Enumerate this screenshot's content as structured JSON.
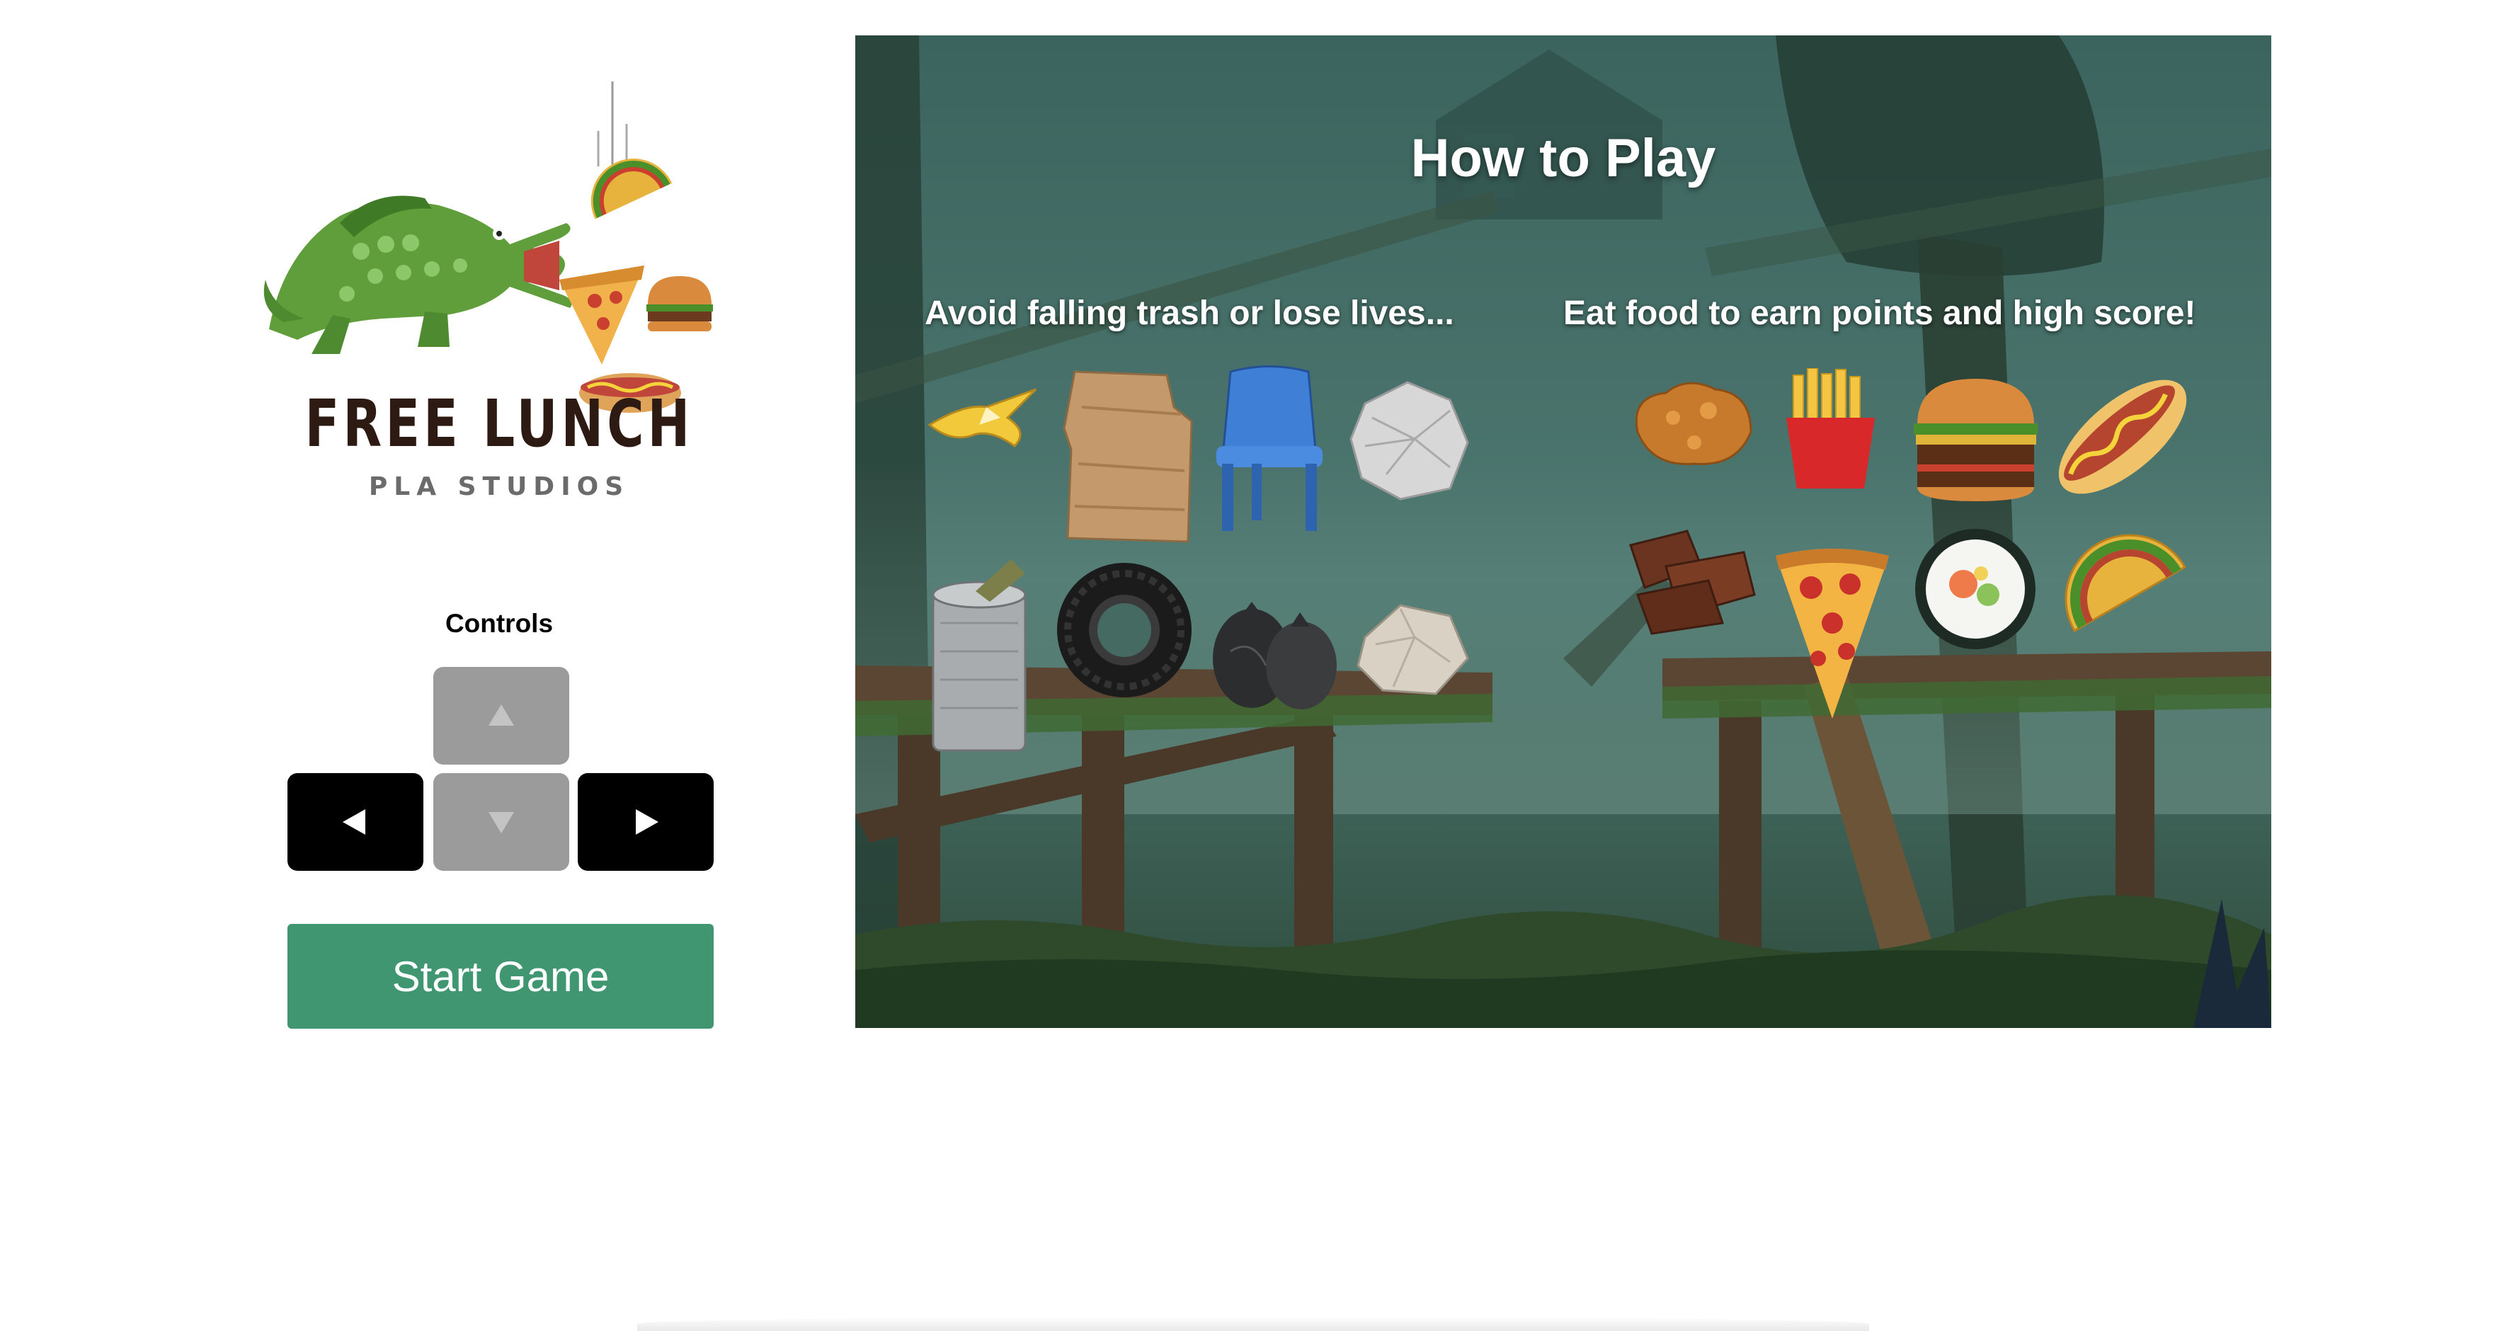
{
  "logo": {
    "title": "FREE LUNCH",
    "subtitle": "PLA STUDIOS"
  },
  "controls": {
    "label": "Controls",
    "keys": [
      {
        "name": "up-arrow-key",
        "icon": "up-arrow-icon",
        "state": "inactive"
      },
      {
        "name": "left-arrow-key",
        "icon": "left-arrow-icon",
        "state": "active"
      },
      {
        "name": "down-arrow-key",
        "icon": "down-arrow-icon",
        "state": "inactive"
      },
      {
        "name": "right-arrow-key",
        "icon": "right-arrow-icon",
        "state": "active"
      }
    ]
  },
  "start_button": {
    "label": "Start Game"
  },
  "how_to_play": {
    "title": "How to Play",
    "trash_heading": "Avoid falling trash or lose lives...",
    "food_heading": "Eat food to earn points and high score!",
    "trash_items": [
      "banana-peel",
      "cardboard",
      "plastic-chair",
      "crumpled-paper",
      "tin-can",
      "tire",
      "trash-bags",
      "foil-ball"
    ],
    "food_items": [
      "fried-chicken",
      "french-fries",
      "burger",
      "hot-dog",
      "jerky",
      "pizza-slice",
      "sushi",
      "taco"
    ]
  },
  "colors": {
    "start_button": "#3f9670",
    "key_active": "#000000",
    "key_inactive": "#9b9b9b",
    "logo_title": "#2d1a12",
    "crocodile": "#5f9e3a",
    "scene_bg": "#3f6b63"
  }
}
